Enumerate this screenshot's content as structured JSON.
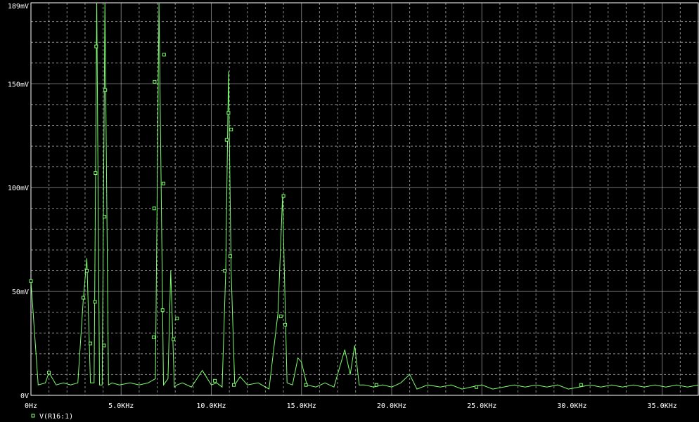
{
  "chart_data": {
    "type": "line",
    "x_unit": "KHz",
    "y_unit": "mV",
    "xlim": [
      0,
      37
    ],
    "ylim": [
      0,
      189
    ],
    "grid": true,
    "legend_position": "bottom-left",
    "background_color": "#000000",
    "grid_color": "#ffffff",
    "trace_color": "#7dff6e",
    "x_ticks": [
      {
        "value": 0,
        "label": "0Hz"
      },
      {
        "value": 5,
        "label": "5.0KHz"
      },
      {
        "value": 10,
        "label": "10.0KHz"
      },
      {
        "value": 15,
        "label": "15.0KHz"
      },
      {
        "value": 20,
        "label": "20.0KHz"
      },
      {
        "value": 25,
        "label": "25.0KHz"
      },
      {
        "value": 30,
        "label": "30.0KHz"
      },
      {
        "value": 35,
        "label": "35.0KHz"
      }
    ],
    "y_ticks": [
      {
        "value": 0,
        "label": "0V"
      },
      {
        "value": 50,
        "label": "50mV"
      },
      {
        "value": 100,
        "label": "100mV"
      },
      {
        "value": 150,
        "label": "150mV"
      },
      {
        "value": 189,
        "label": "189mV"
      }
    ],
    "series": [
      {
        "name": "V(R16:1)",
        "x": [
          0,
          0.4,
          0.8,
          1.0,
          1.4,
          1.8,
          2.2,
          2.6,
          2.9,
          3.1,
          3.3,
          3.5,
          3.65,
          3.8,
          3.95,
          4.1,
          4.3,
          4.5,
          4.9,
          5.5,
          6.0,
          6.5,
          6.9,
          7.1,
          7.35,
          7.6,
          7.75,
          7.95,
          8.1,
          8.4,
          8.9,
          9.5,
          10.0,
          10.3,
          10.6,
          10.8,
          10.95,
          11.1,
          11.3,
          11.6,
          12.0,
          12.6,
          13.2,
          13.7,
          13.95,
          14.2,
          14.5,
          14.8,
          15.0,
          15.3,
          15.8,
          16.3,
          16.8,
          17.4,
          17.7,
          17.95,
          18.2,
          18.5,
          19.0,
          19.5,
          20.0,
          20.5,
          21.0,
          21.4,
          22.0,
          22.7,
          23.3,
          23.9,
          24.4,
          25.0,
          25.6,
          26.2,
          26.8,
          27.4,
          28.0,
          28.6,
          29.2,
          29.8,
          30.4,
          31.0,
          31.6,
          32.2,
          32.8,
          33.4,
          34.0,
          34.6,
          35.2,
          35.8,
          36.4,
          37.0
        ],
        "values": [
          55,
          5,
          6,
          11,
          5,
          6,
          5,
          6,
          46,
          66,
          6,
          6,
          190,
          5,
          5,
          190,
          5,
          6,
          5,
          6,
          5,
          6,
          8,
          190,
          5,
          8,
          60,
          4,
          5,
          6,
          4,
          12,
          5,
          6,
          4,
          60,
          156,
          60,
          5,
          9,
          5,
          6,
          3,
          40,
          96,
          6,
          5,
          18,
          16,
          5,
          4,
          6,
          4,
          22,
          10,
          24,
          5,
          5,
          4,
          5,
          4,
          6,
          10,
          3,
          5,
          4,
          5,
          3,
          4,
          5,
          3,
          4,
          5,
          4,
          5,
          4,
          5,
          3,
          4,
          5,
          4,
          5,
          4,
          5,
          4,
          5,
          4,
          5,
          4,
          5
        ],
        "marker_x": [
          0,
          1.0,
          2.9,
          3.1,
          3.3,
          3.55,
          3.58,
          3.62,
          4.05,
          4.08,
          4.12,
          6.8,
          6.83,
          6.86,
          7.3,
          7.35,
          7.38,
          7.9,
          8.1,
          10.2,
          10.75,
          10.85,
          10.95,
          11.05,
          11.1,
          11.25,
          13.85,
          14.0,
          14.1,
          15.25,
          19.15,
          24.7,
          30.5
        ],
        "marker_y": [
          55,
          11,
          47,
          60,
          25,
          45,
          107,
          168,
          24,
          86,
          147,
          28,
          90,
          151,
          41,
          102,
          164,
          27,
          37,
          7,
          60,
          123,
          136,
          67,
          128,
          5,
          38,
          96,
          34,
          5,
          5,
          4,
          5
        ]
      }
    ]
  }
}
